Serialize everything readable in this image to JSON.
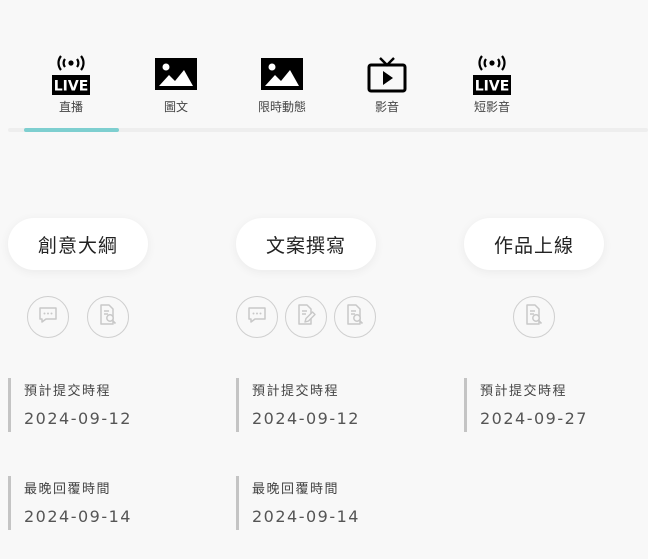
{
  "tabs": [
    {
      "label": "直播",
      "icon": "live-icon",
      "badge": "LIVE",
      "active": true
    },
    {
      "label": "圖文",
      "icon": "image-icon"
    },
    {
      "label": "限時動態",
      "icon": "image-icon"
    },
    {
      "label": "影音",
      "icon": "tv-play-icon"
    },
    {
      "label": "短影音",
      "icon": "live-icon",
      "badge": "LIVE"
    }
  ],
  "colors": {
    "indicator": "#7ecfd0",
    "info_bar": "#c4c4c4"
  },
  "stages": [
    {
      "title": "創意大綱",
      "actions": [
        "comment-icon",
        "document-search-icon"
      ],
      "deadline_label": "預計提交時程",
      "deadline": "2024-09-12",
      "reply_label": "最晚回覆時間",
      "reply": "2024-09-14"
    },
    {
      "title": "文案撰寫",
      "actions": [
        "comment-icon",
        "document-edit-icon",
        "document-search-icon"
      ],
      "deadline_label": "預計提交時程",
      "deadline": "2024-09-12",
      "reply_label": "最晚回覆時間",
      "reply": "2024-09-14"
    },
    {
      "title": "作品上線",
      "actions": [
        "document-search-icon"
      ],
      "deadline_label": "預計提交時程",
      "deadline": "2024-09-27"
    }
  ]
}
